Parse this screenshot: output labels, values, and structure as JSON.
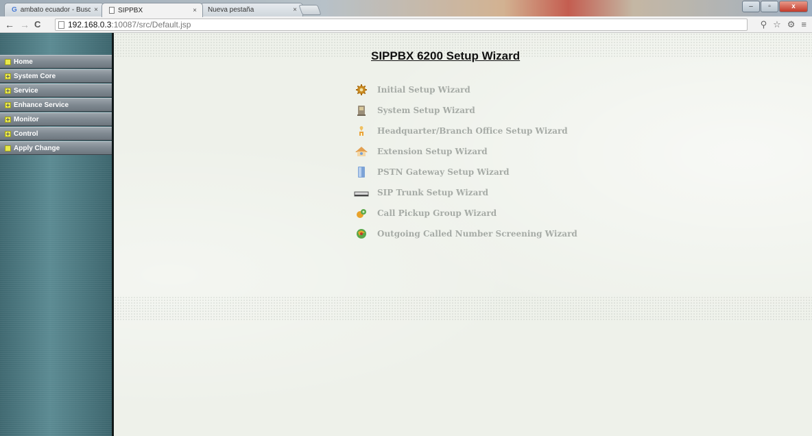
{
  "browser": {
    "tabs": [
      {
        "title": "ambato ecuador - Buscar",
        "close": "×"
      },
      {
        "title": "SIPPBX",
        "close": "×"
      },
      {
        "title": "Nueva pestaña",
        "close": "×"
      }
    ],
    "url_host": "192.168.0.3",
    "url_rest": ":10087/src/Default.jsp",
    "controls": {
      "minimize": "–",
      "maximize": "▫",
      "close": "x"
    }
  },
  "sidebar": {
    "items": [
      {
        "label": "Home",
        "icon": "square"
      },
      {
        "label": "System Core",
        "icon": "plus"
      },
      {
        "label": "Service",
        "icon": "plus"
      },
      {
        "label": "Enhance Service",
        "icon": "plus"
      },
      {
        "label": "Monitor",
        "icon": "plus"
      },
      {
        "label": "Control",
        "icon": "plus"
      },
      {
        "label": "Apply Change",
        "icon": "square"
      }
    ]
  },
  "main": {
    "title": "SIPPBX 6200 Setup Wizard",
    "wizards": [
      {
        "label": "Initial Setup Wizard",
        "icon": "gear-icon"
      },
      {
        "label": "System Setup Wizard",
        "icon": "computer-icon"
      },
      {
        "label": "Headquarter/Branch Office Setup Wizard",
        "icon": "office-icon"
      },
      {
        "label": "Extension Setup Wizard",
        "icon": "extension-icon"
      },
      {
        "label": "PSTN Gateway Setup Wizard",
        "icon": "gateway-icon"
      },
      {
        "label": "SIP Trunk Setup Wizard",
        "icon": "trunk-icon"
      },
      {
        "label": "Call Pickup Group Wizard",
        "icon": "pickup-group-icon"
      },
      {
        "label": "Outgoing Called Number Screening Wizard",
        "icon": "screening-icon"
      }
    ]
  }
}
